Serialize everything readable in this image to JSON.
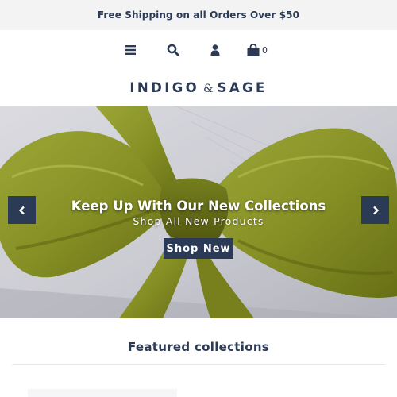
{
  "announcement": {
    "text": "Free Shipping on all Orders Over $50"
  },
  "header": {
    "icons": [
      "menu-icon",
      "search-icon",
      "account-icon",
      "cart-icon"
    ],
    "cart_count": "0",
    "logo": {
      "left": "INDIGO",
      "amp": "&",
      "right": "SAGE"
    }
  },
  "hero": {
    "title": "Keep Up With Our New Collections",
    "subtitle": "Shop All New Products",
    "button_label": "Shop New",
    "prev_icon": "chevron-left-icon",
    "next_icon": "chevron-right-icon"
  },
  "featured": {
    "title": "Featured collections"
  },
  "colors": {
    "primary": "#2b3a55",
    "announcement_bg": "#f3f3f3",
    "bow_green": "#8f9a28"
  }
}
